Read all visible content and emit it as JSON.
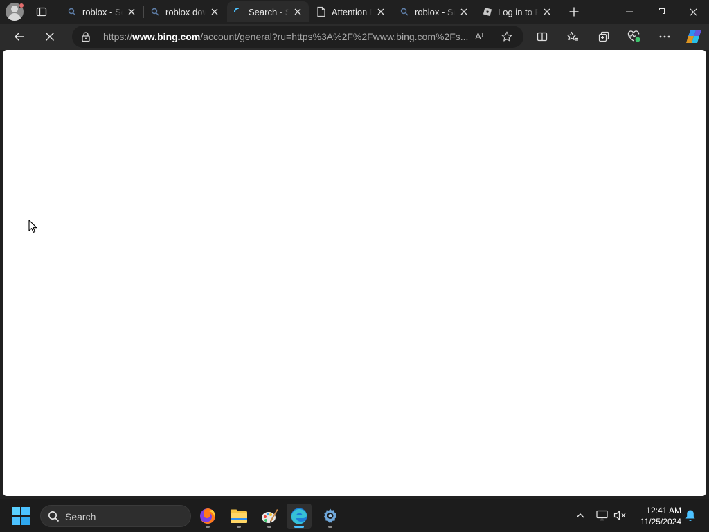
{
  "browser": {
    "tabs": [
      {
        "title": "roblox - Search",
        "icon": "search-icon",
        "active": false
      },
      {
        "title": "roblox download",
        "icon": "search-icon",
        "active": false
      },
      {
        "title": "Search - Sign in",
        "icon": "loading-spinner-icon",
        "active": true
      },
      {
        "title": "Attention Required",
        "icon": "page-icon",
        "active": false
      },
      {
        "title": "roblox - Search",
        "icon": "search-icon",
        "active": false
      },
      {
        "title": "Log in to Roblox",
        "icon": "roblox-icon",
        "active": false
      }
    ],
    "address": {
      "url_prefix": "https://",
      "url_domain": "www.bing.com",
      "url_rest": "/account/general?ru=https%3A%2F%2Fwww.bing.com%2Fs...",
      "read_aloud_label": "A⁾"
    },
    "colors": {
      "accent": "#4cc2ff",
      "page_background": "#ffffff",
      "frame": "#202020"
    }
  },
  "taskbar": {
    "search_placeholder": "Search",
    "apps": [
      "firefox-icon",
      "file-explorer-icon",
      "paint-icon",
      "edge-icon",
      "settings-icon"
    ],
    "clock": {
      "time": "12:41 AM",
      "date": "11/25/2024"
    }
  }
}
